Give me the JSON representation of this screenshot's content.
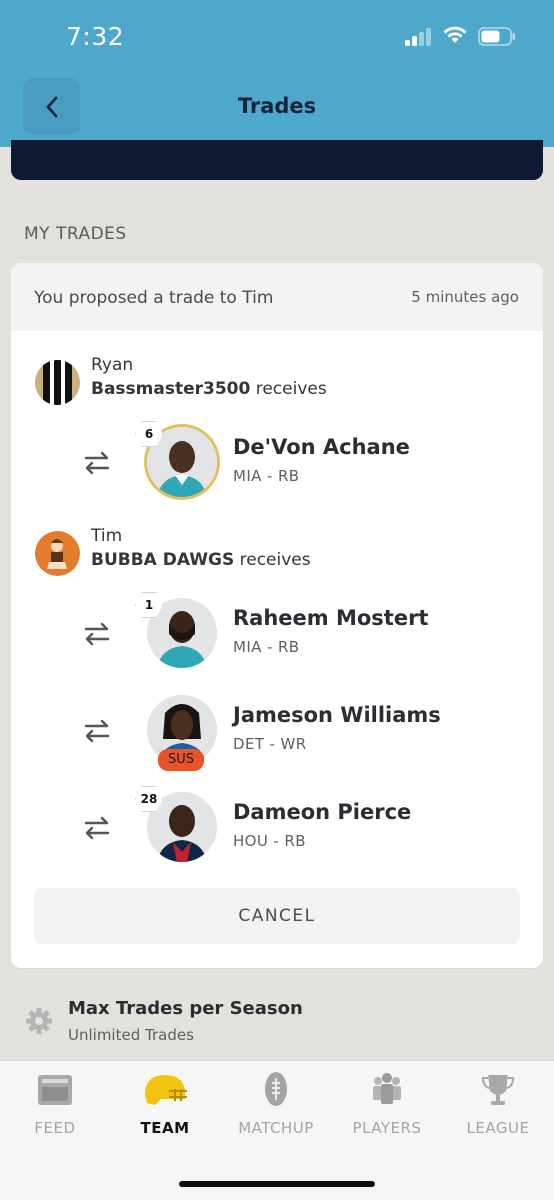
{
  "status_bar": {
    "time": "7:32"
  },
  "header": {
    "title": "Trades"
  },
  "section": {
    "label": "MY TRADES"
  },
  "trade": {
    "title": "You proposed a trade to Tim",
    "time_ago": "5 minutes ago",
    "teams": [
      {
        "owner": "Ryan",
        "team_name": "Bassmaster3500",
        "receives_label": "receives",
        "players": [
          {
            "rank": "6",
            "name": "De'Von Achane",
            "position": "MIA - RB",
            "status": ""
          }
        ]
      },
      {
        "owner": "Tim",
        "team_name": "BUBBA DAWGS",
        "receives_label": "receives",
        "players": [
          {
            "rank": "1",
            "name": "Raheem Mostert",
            "position": "MIA - RB",
            "status": ""
          },
          {
            "rank": "",
            "name": "Jameson Williams",
            "position": "DET - WR",
            "status": "SUS"
          },
          {
            "rank": "28",
            "name": "Dameon Pierce",
            "position": "HOU - RB",
            "status": ""
          }
        ]
      }
    ],
    "cancel_label": "CANCEL"
  },
  "settings": {
    "title": "Max Trades per Season",
    "value": "Unlimited Trades"
  },
  "tabbar": {
    "tabs": [
      {
        "label": "FEED",
        "icon": "feed-icon",
        "active": false
      },
      {
        "label": "TEAM",
        "icon": "helmet-icon",
        "active": true
      },
      {
        "label": "MATCHUP",
        "icon": "football-icon",
        "active": false
      },
      {
        "label": "PLAYERS",
        "icon": "players-icon",
        "active": false
      },
      {
        "label": "LEAGUE",
        "icon": "trophy-icon",
        "active": false
      }
    ]
  },
  "colors": {
    "header_bg": "#4ea8cb",
    "dark_strip": "#0e1a33",
    "sus_badge": "#e8532a",
    "gold_ring": "#e2c15d",
    "active_tab_icon": "#f2c40f"
  }
}
